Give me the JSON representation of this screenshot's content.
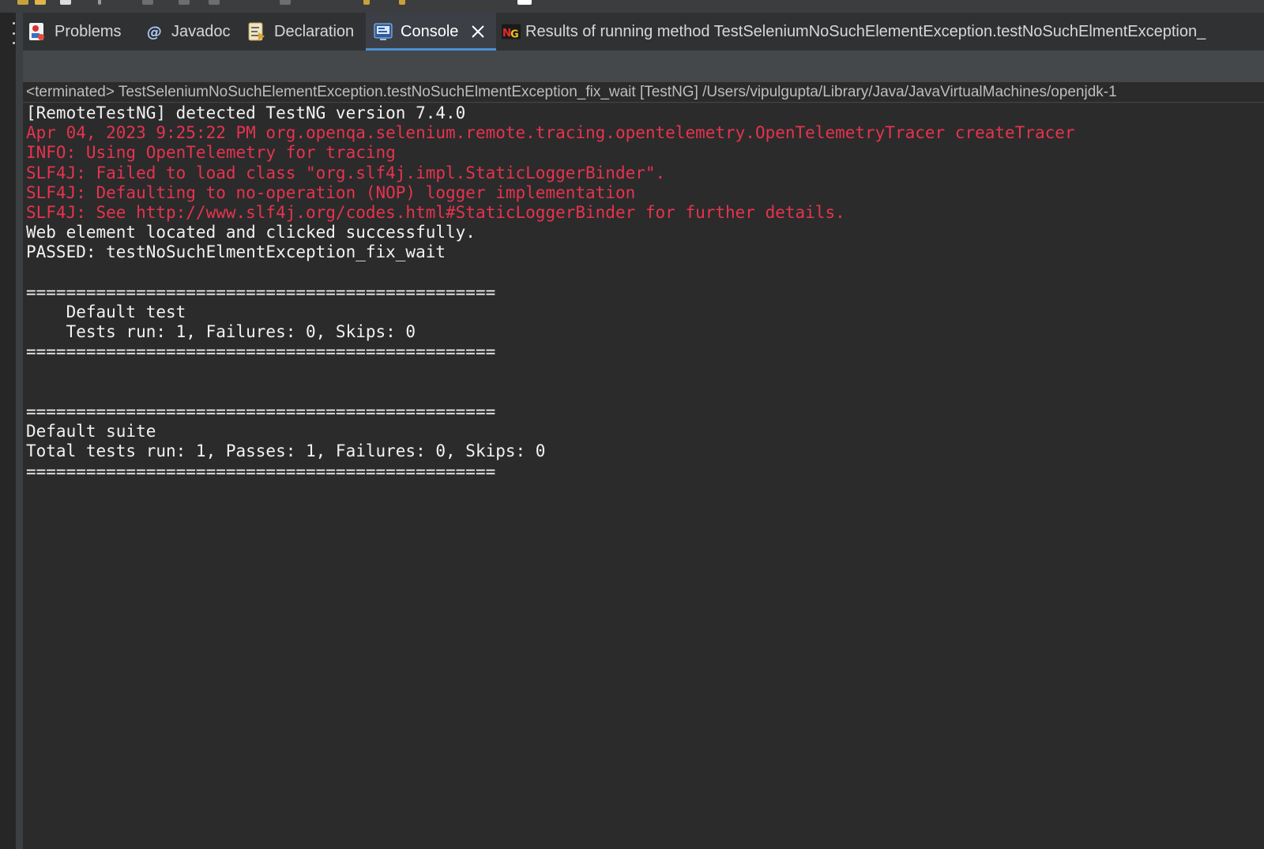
{
  "tabs": [
    {
      "label": "Problems",
      "icon": "problems-icon"
    },
    {
      "label": "Javadoc",
      "icon": "javadoc-icon"
    },
    {
      "label": "Declaration",
      "icon": "declaration-icon"
    },
    {
      "label": "Console",
      "icon": "console-icon",
      "active": true
    },
    {
      "label": "Results of running method TestSeleniumNoSuchElementException.testNoSuchElmentException_",
      "icon": "testng-icon"
    }
  ],
  "console": {
    "header": "<terminated> TestSeleniumNoSuchElementException.testNoSuchElmentException_fix_wait [TestNG] /Users/vipulgupta/Library/Java/JavaVirtualMachines/openjdk-1",
    "lines": [
      {
        "text": "[RemoteTestNG] detected TestNG version 7.4.0",
        "type": "out"
      },
      {
        "text": "Apr 04, 2023 9:25:22 PM org.openqa.selenium.remote.tracing.opentelemetry.OpenTelemetryTracer createTracer",
        "type": "err"
      },
      {
        "text": "INFO: Using OpenTelemetry for tracing",
        "type": "err"
      },
      {
        "text": "SLF4J: Failed to load class \"org.slf4j.impl.StaticLoggerBinder\".",
        "type": "err"
      },
      {
        "text": "SLF4J: Defaulting to no-operation (NOP) logger implementation",
        "type": "err"
      },
      {
        "text": "SLF4J: See http://www.slf4j.org/codes.html#StaticLoggerBinder for further details.",
        "type": "err"
      },
      {
        "text": "Web element located and clicked successfully.",
        "type": "out"
      },
      {
        "text": "PASSED: testNoSuchElmentException_fix_wait",
        "type": "out"
      },
      {
        "text": "",
        "type": "out"
      },
      {
        "text": "===============================================",
        "type": "out"
      },
      {
        "text": "    Default test",
        "type": "out"
      },
      {
        "text": "    Tests run: 1, Failures: 0, Skips: 0",
        "type": "out"
      },
      {
        "text": "===============================================",
        "type": "out"
      },
      {
        "text": "",
        "type": "out"
      },
      {
        "text": "",
        "type": "out"
      },
      {
        "text": "===============================================",
        "type": "out"
      },
      {
        "text": "Default suite",
        "type": "out"
      },
      {
        "text": "Total tests run: 1, Passes: 1, Failures: 0, Skips: 0",
        "type": "out"
      },
      {
        "text": "===============================================",
        "type": "out"
      }
    ]
  },
  "colors": {
    "stdout": "#f2f2f2",
    "stderr": "#e6334f",
    "active_tab_underline": "#4a8fd8"
  }
}
